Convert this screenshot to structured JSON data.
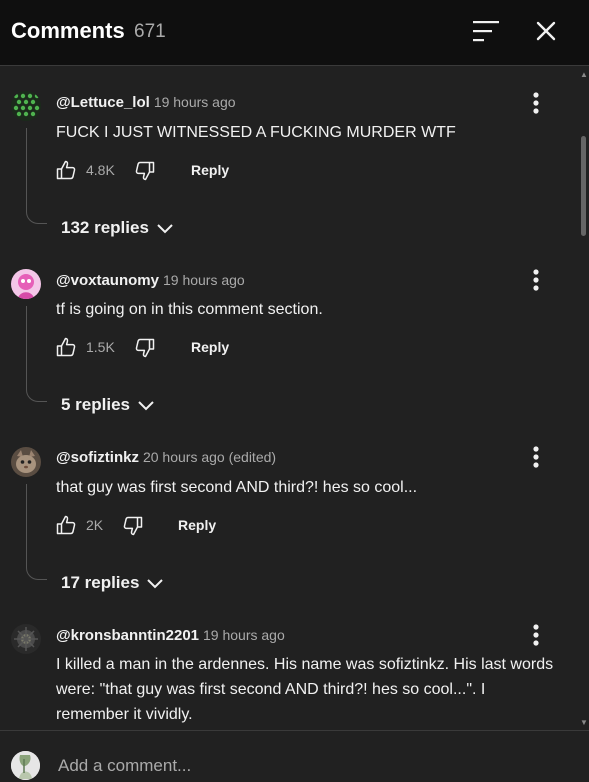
{
  "header": {
    "title": "Comments",
    "count": "671"
  },
  "comments": [
    {
      "author": "@Lettuce_lol",
      "time": "19 hours ago",
      "text": "FUCK I JUST WITNESSED A FUCKING MURDER WTF",
      "likes": "4.8K",
      "reply_label": "Reply",
      "replies_label": "132 replies"
    },
    {
      "author": "@voxtaunomy",
      "time": "19 hours ago",
      "text": "tf is going on in this comment section.",
      "likes": "1.5K",
      "reply_label": "Reply",
      "replies_label": "5 replies"
    },
    {
      "author": "@sofiztinkz",
      "time": "20 hours ago (edited)",
      "text": "that guy was first second AND third?! hes so cool...",
      "likes": "2K",
      "reply_label": "Reply",
      "replies_label": "17 replies"
    },
    {
      "author": "@kronsbanntin2201",
      "time": "19 hours ago",
      "text": "I killed a man in the ardennes. His name was sofiztinkz. His last words were: \"that guy was first second AND third?! hes so cool...\". I remember it vividly."
    }
  ],
  "footer": {
    "placeholder": "Add a comment..."
  },
  "colors": {
    "background": "#212121",
    "header_bg": "#0f0f0f",
    "text": "#f1f1f1",
    "muted": "#aaaaaa"
  }
}
